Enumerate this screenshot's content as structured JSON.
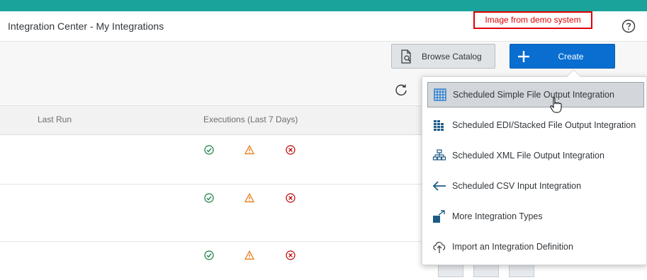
{
  "header": {
    "title": "Integration Center - My Integrations",
    "demo_banner": "Image from demo system",
    "help_icon": "question-circle-icon"
  },
  "toolbar": {
    "browse_label": "Browse Catalog",
    "browse_icon": "catalog-search-icon",
    "create_label": "Create",
    "create_icon": "plus-icon",
    "refresh_icon": "refresh-icon"
  },
  "table": {
    "columns": [
      "Last Run",
      "Executions (Last 7 Days)"
    ],
    "rows": [
      {
        "success": "success-icon",
        "warning": "warning-icon",
        "error": "error-icon"
      },
      {
        "success": "success-icon",
        "warning": "warning-icon",
        "error": "error-icon"
      },
      {
        "success": "success-icon",
        "warning": "warning-icon",
        "error": "error-icon"
      }
    ]
  },
  "create_menu": {
    "items": [
      {
        "label": "Scheduled Simple File Output Integration",
        "icon": "grid-table-icon"
      },
      {
        "label": "Scheduled EDI/Stacked File Output Integration",
        "icon": "stacked-blocks-icon"
      },
      {
        "label": "Scheduled XML File Output Integration",
        "icon": "hierarchy-icon"
      },
      {
        "label": "Scheduled CSV Input Integration",
        "icon": "arrow-left-icon"
      },
      {
        "label": "More Integration Types",
        "icon": "open-external-icon"
      },
      {
        "label": "Import an Integration Definition",
        "icon": "cloud-upload-icon"
      }
    ]
  },
  "colors": {
    "accent": "#0a6ed1",
    "top_strip": "#1aa39a",
    "success": "#107e3e",
    "warning": "#e9730c",
    "error": "#bb0000"
  }
}
